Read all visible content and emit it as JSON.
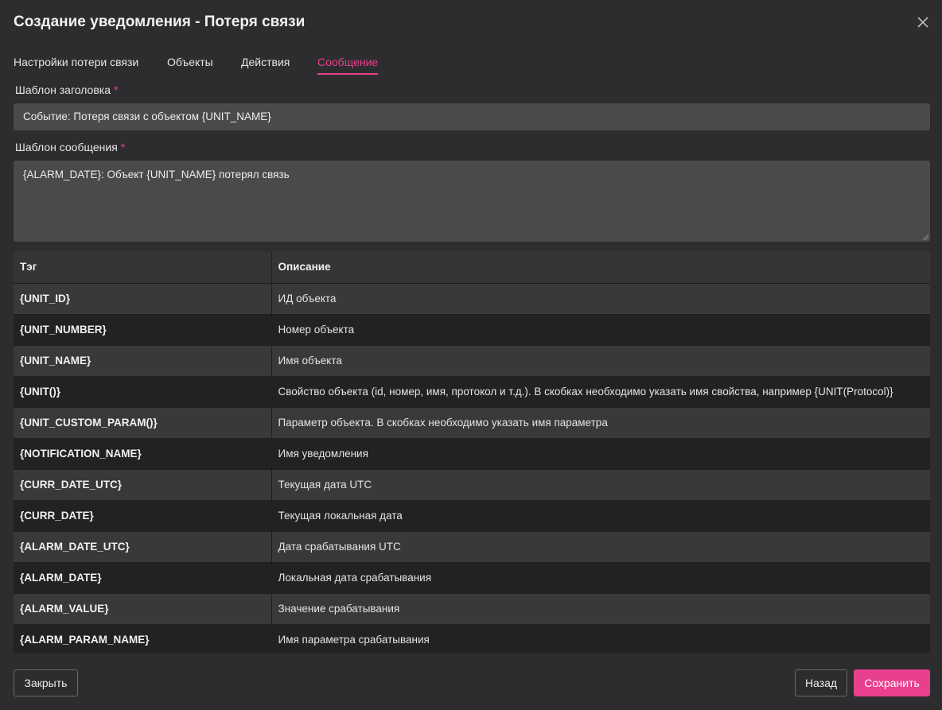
{
  "dialog": {
    "title": "Создание уведомления - Потеря связи",
    "close_icon": "close-icon"
  },
  "tabs": [
    {
      "label": "Настройки потери связи",
      "active": false
    },
    {
      "label": "Объекты",
      "active": false
    },
    {
      "label": "Действия",
      "active": false
    },
    {
      "label": "Сообщение",
      "active": true
    }
  ],
  "form": {
    "header_template": {
      "label": "Шаблон заголовка",
      "required_mark": "*",
      "value": "Событие: Потеря связи с объектом {UNIT_NAME}"
    },
    "message_template": {
      "label": "Шаблон сообщения",
      "required_mark": "*",
      "value": "{ALARM_DATE}: Объект {UNIT_NAME} потерял связь"
    }
  },
  "table": {
    "columns": [
      "Тэг",
      "Описание"
    ],
    "rows": [
      {
        "tag": "{UNIT_ID}",
        "description": "ИД объекта"
      },
      {
        "tag": "{UNIT_NUMBER}",
        "description": "Номер объекта"
      },
      {
        "tag": "{UNIT_NAME}",
        "description": "Имя объекта"
      },
      {
        "tag": "{UNIT()}",
        "description": "Свойство объекта (id, номер, имя, протокол и т.д.). В скобках необходимо указать имя свойства, например {UNIT(Protocol)}"
      },
      {
        "tag": "{UNIT_CUSTOM_PARAM()}",
        "description": "Параметр объекта. В скобках необходимо указать имя параметра"
      },
      {
        "tag": "{NOTIFICATION_NAME}",
        "description": "Имя уведомления"
      },
      {
        "tag": "{CURR_DATE_UTC}",
        "description": "Текущая дата UTC"
      },
      {
        "tag": "{CURR_DATE}",
        "description": "Текущая локальная дата"
      },
      {
        "tag": "{ALARM_DATE_UTC}",
        "description": "Дата срабатывания UTC"
      },
      {
        "tag": "{ALARM_DATE}",
        "description": "Локальная дата срабатывания"
      },
      {
        "tag": "{ALARM_VALUE}",
        "description": "Значение срабатывания"
      },
      {
        "tag": "{ALARM_PARAM_NAME}",
        "description": "Имя параметра срабатывания"
      }
    ]
  },
  "footer": {
    "close_label": "Закрыть",
    "back_label": "Назад",
    "save_label": "Сохранить"
  },
  "colors": {
    "accent": "#e8408c",
    "background": "#2d2d2f",
    "input_bg": "#4a4a4c"
  }
}
